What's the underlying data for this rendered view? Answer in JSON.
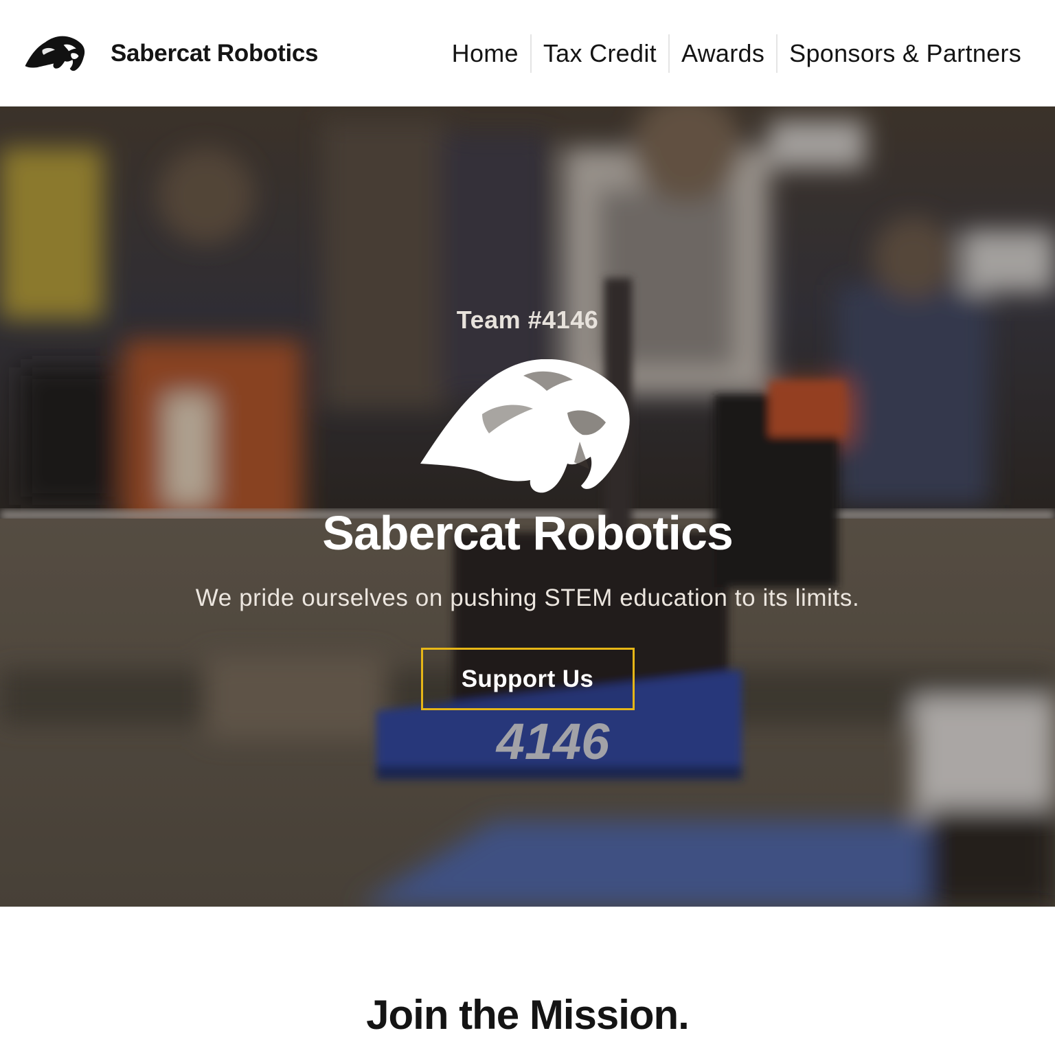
{
  "header": {
    "brand_name": "Sabercat Robotics",
    "logo_icon": "sabercat-head-icon",
    "nav": [
      {
        "label": "Home"
      },
      {
        "label": "Tax Credit"
      },
      {
        "label": "Awards"
      },
      {
        "label": "Sponsors & Partners"
      }
    ]
  },
  "hero": {
    "eyebrow": "Team #4146",
    "title": "Sabercat Robotics",
    "subtitle": "We pride ourselves on pushing STEM education to its limits.",
    "cta_label": "Support Us",
    "robot_number": "4146",
    "logo_icon": "sabercat-head-icon",
    "colors": {
      "cta_border": "#e6b617",
      "robot_bumper": "#2e47a5"
    }
  },
  "mission": {
    "title": "Join the Mission."
  }
}
